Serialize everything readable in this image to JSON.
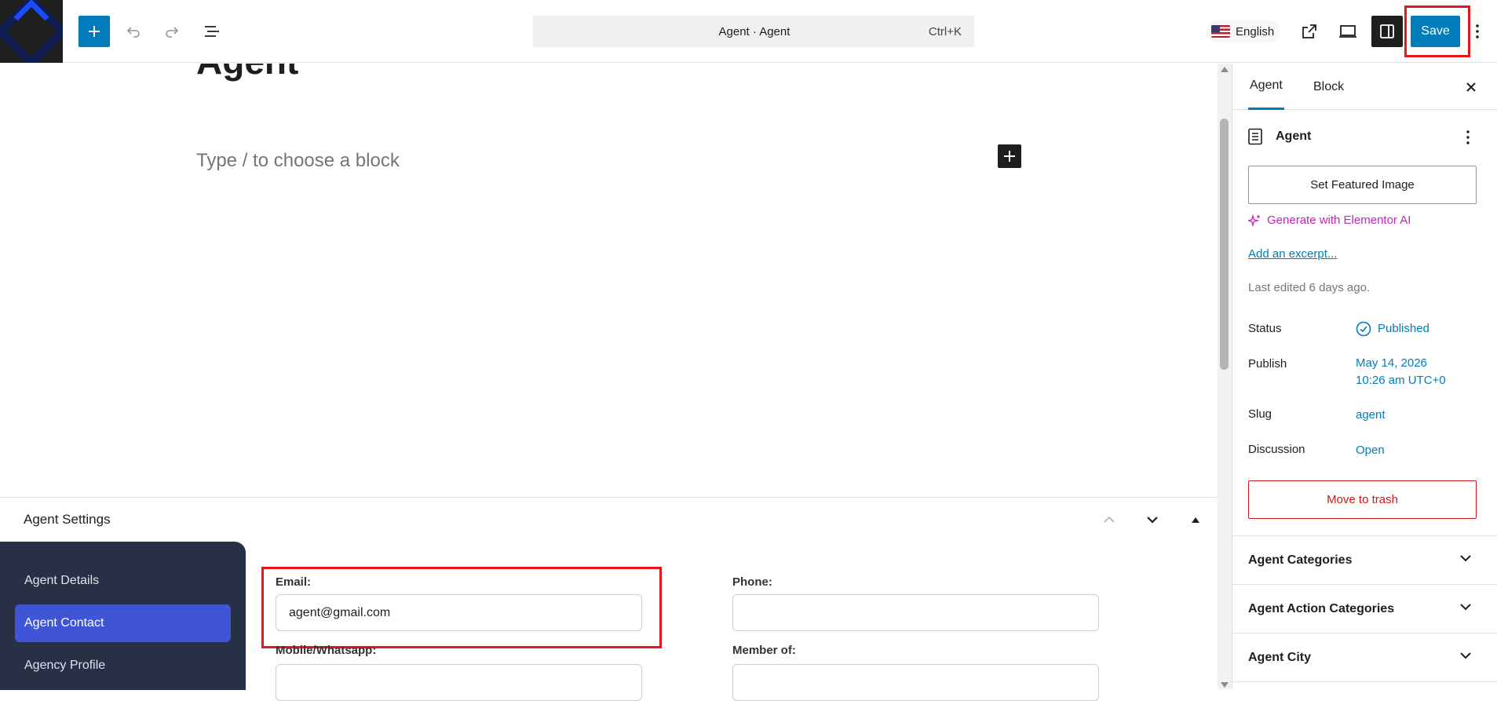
{
  "header": {
    "document_title": "Agent · Agent",
    "shortcut": "Ctrl+K",
    "language": "English",
    "save_label": "Save"
  },
  "editor": {
    "post_title": "Agent",
    "block_placeholder": "Type / to choose a block"
  },
  "metabox": {
    "title": "Agent Settings",
    "nav": [
      "Agent Details",
      "Agent Contact",
      "Agency Profile"
    ],
    "active_nav": "Agent Contact",
    "fields": {
      "email_label": "Email:",
      "email_value": "agent@gmail.com",
      "phone_label": "Phone:",
      "phone_value": "",
      "mobile_label": "Mobile/Whatsapp:",
      "mobile_value": "",
      "member_label": "Member of:",
      "member_value": ""
    }
  },
  "sidebar": {
    "tabs": [
      "Agent",
      "Block"
    ],
    "active_tab": "Agent",
    "doc_type": "Agent",
    "featured_image_label": "Set Featured Image",
    "ai_label": "Generate with Elementor AI",
    "excerpt_label": "Add an excerpt...",
    "last_edited": "Last edited 6 days ago.",
    "status_label": "Status",
    "status_value": "Published",
    "publish_label": "Publish",
    "publish_date": "May 14, 2026",
    "publish_time": "10:26 am UTC+0",
    "slug_label": "Slug",
    "slug_value": "agent",
    "discussion_label": "Discussion",
    "discussion_value": "Open",
    "trash_label": "Move to trash",
    "panels": [
      "Agent Categories",
      "Agent Action Categories",
      "Agent City"
    ]
  },
  "colors": {
    "accent": "#007cba",
    "highlight_box": "#e8161a",
    "nav_bg": "#283046",
    "nav_active": "#4055d6",
    "ai_color": "#c226b5",
    "danger": "#cc1818"
  }
}
